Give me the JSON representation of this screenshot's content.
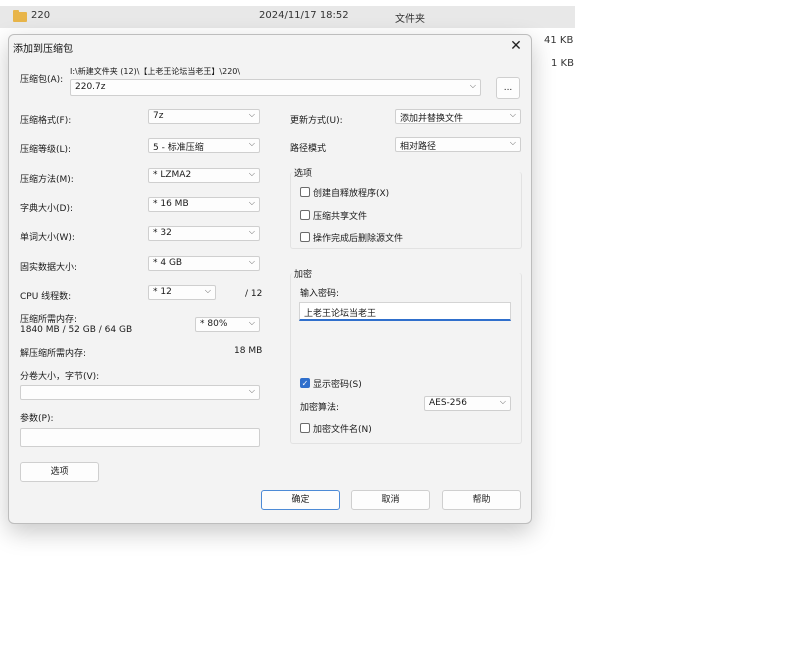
{
  "explorer": {
    "row": {
      "name": "220",
      "date": "2024/11/17 18:52",
      "type": "文件夹"
    },
    "sizes": [
      "41 KB",
      "1 KB"
    ]
  },
  "dialog": {
    "title": "添加到压缩包",
    "close_glyph": "✕",
    "archive": {
      "label": "压缩包(A):",
      "path": "I:\\新建文件夹 (12)\\【上老王论坛当老王】\\220\\",
      "value": "220.7z",
      "browse_label": "..."
    },
    "left": {
      "format": {
        "label": "压缩格式(F):",
        "value": "7z"
      },
      "level": {
        "label": "压缩等级(L):",
        "value": "5 - 标准压缩"
      },
      "method": {
        "label": "压缩方法(M):",
        "value": "* LZMA2"
      },
      "dict": {
        "label": "字典大小(D):",
        "value": "* 16 MB"
      },
      "word": {
        "label": "单词大小(W):",
        "value": "* 32"
      },
      "solid": {
        "label": "固实数据大小:",
        "value": "* 4 GB"
      },
      "cpu": {
        "label": "CPU 线程数:",
        "value": "* 12",
        "max": "/ 12"
      },
      "mem_comp": {
        "label": "压缩所需内存:",
        "detail": "1840 MB / 52 GB / 64 GB",
        "value": "* 80%"
      },
      "mem_decomp": {
        "label": "解压缩所需内存:",
        "value": "18 MB"
      },
      "split": {
        "label": "分卷大小，字节(V):",
        "value": ""
      },
      "params": {
        "label": "参数(P):",
        "value": ""
      },
      "options_button": "选项"
    },
    "right": {
      "update": {
        "label": "更新方式(U):",
        "value": "添加并替换文件"
      },
      "path_mode": {
        "label": "路径模式",
        "value": "相对路径"
      },
      "options_group": {
        "title": "选项",
        "items": [
          {
            "label": "创建自释放程序(X)",
            "checked": false
          },
          {
            "label": "压缩共享文件",
            "checked": false
          },
          {
            "label": "操作完成后删除源文件",
            "checked": false
          }
        ]
      },
      "encryption": {
        "title": "加密",
        "password_label": "输入密码:",
        "password_value": "上老王论坛当老王",
        "show_password": {
          "label": "显示密码(S)",
          "checked": true
        },
        "method": {
          "label": "加密算法:",
          "value": "AES-256"
        },
        "encrypt_names": {
          "label": "加密文件名(N)",
          "checked": false
        }
      }
    },
    "buttons": {
      "ok": "确定",
      "cancel": "取消",
      "help": "帮助"
    }
  },
  "icons": {
    "dropdown": "chevron-down-icon",
    "check": "✓",
    "chevron": "⌵"
  }
}
